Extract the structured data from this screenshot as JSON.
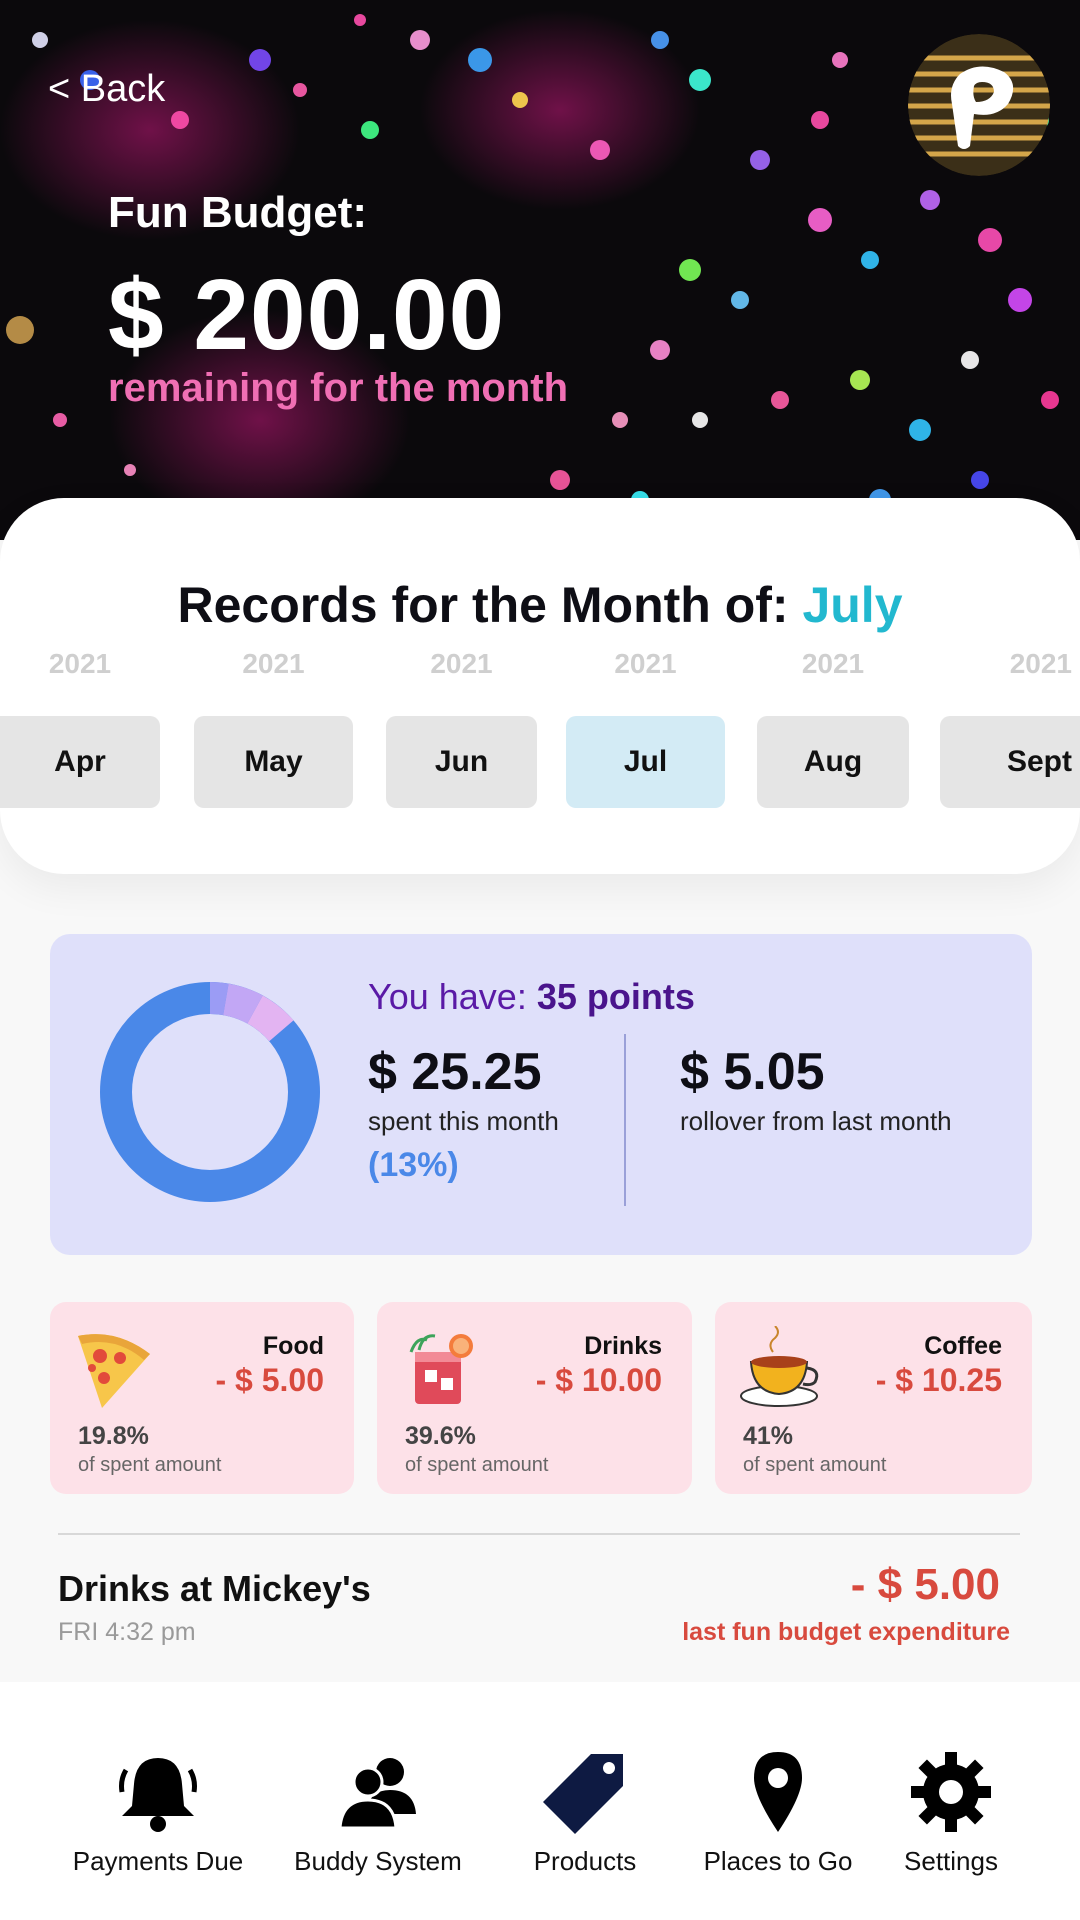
{
  "header": {
    "back_label": "< Back",
    "budget_label": "Fun Budget:",
    "budget_amount": "$ 200.00",
    "budget_sub": "remaining for the month"
  },
  "records": {
    "title_prefix": "Records for the Month of:",
    "title_month": "July",
    "months": [
      {
        "year": "2021",
        "label": "Apr",
        "active": false
      },
      {
        "year": "2021",
        "label": "May",
        "active": false
      },
      {
        "year": "2021",
        "label": "Jun",
        "active": false
      },
      {
        "year": "2021",
        "label": "Jul",
        "active": true
      },
      {
        "year": "2021",
        "label": "Aug",
        "active": false
      },
      {
        "year": "2021",
        "label": "Sept",
        "active": false
      }
    ]
  },
  "summary": {
    "points_prefix": "You have:",
    "points_value": "35 points",
    "spent_amount": "$ 25.25",
    "spent_label": "spent this month",
    "spent_percent": "(13%)",
    "rollover_amount": "$ 5.05",
    "rollover_label": "rollover from last month",
    "donut_colors": {
      "remaining": "#4a88e8",
      "food": "#9b9cf5",
      "drinks": "#c2a7f5",
      "coffee": "#e3b4f2"
    }
  },
  "categories": [
    {
      "name": "Food",
      "amount": "- $ 5.00",
      "percent": "19.8%",
      "percent_label": "of spent amount",
      "icon": "pizza-icon"
    },
    {
      "name": "Drinks",
      "amount": "- $ 10.00",
      "percent": "39.6%",
      "percent_label": "of spent amount",
      "icon": "cocktail-icon"
    },
    {
      "name": "Coffee",
      "amount": "- $ 10.25",
      "percent": "41%",
      "percent_label": "of spent amount",
      "icon": "coffee-cup-icon"
    }
  ],
  "last_expense": {
    "title": "Drinks at Mickey's",
    "time": "FRI 4:32 pm",
    "amount": "- $ 5.00",
    "label": "last fun budget expenditure"
  },
  "nav": [
    {
      "label": "Payments Due",
      "icon": "bell-icon"
    },
    {
      "label": "Buddy System",
      "icon": "people-icon"
    },
    {
      "label": "Products",
      "icon": "tag-icon"
    },
    {
      "label": "Places to Go",
      "icon": "map-pin-icon"
    },
    {
      "label": "Settings",
      "icon": "gear-icon"
    }
  ]
}
